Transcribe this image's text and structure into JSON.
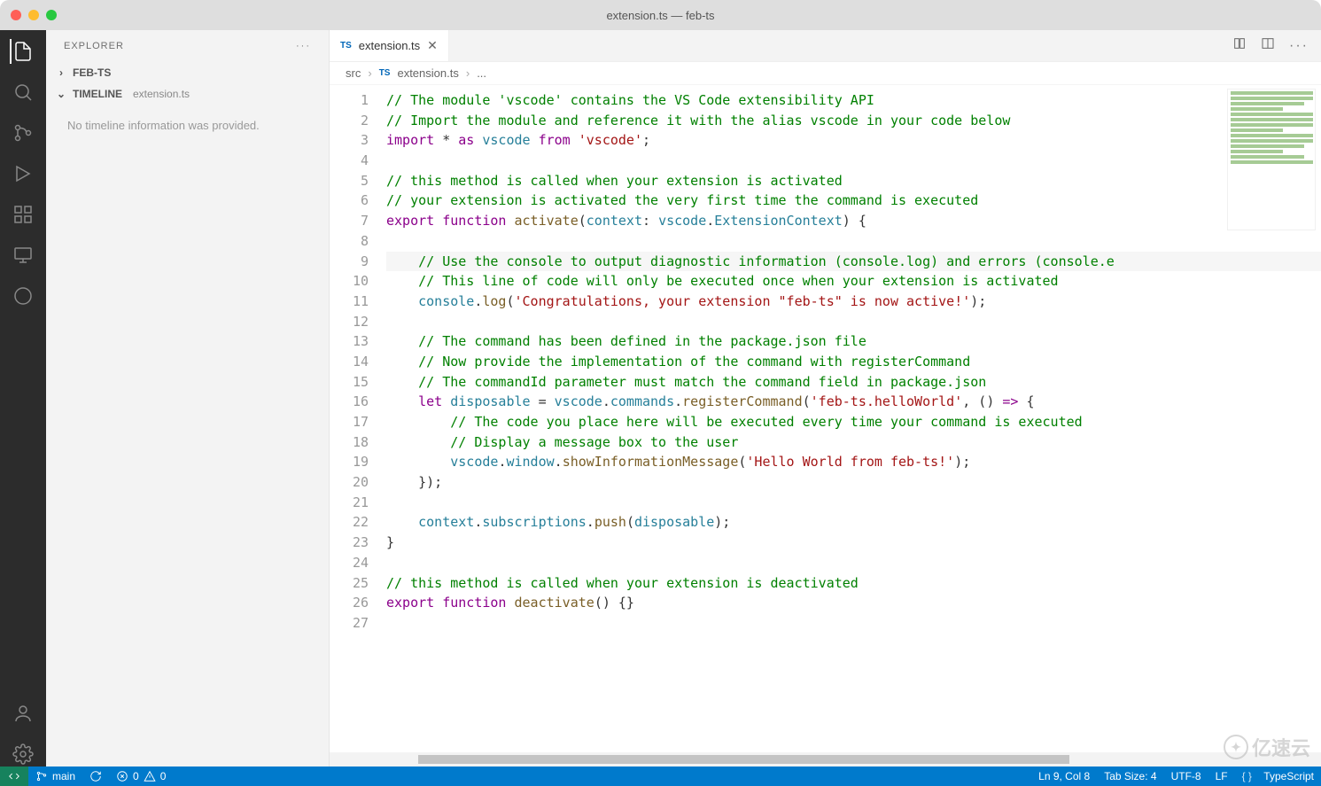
{
  "window": {
    "title": "extension.ts — feb-ts"
  },
  "sidebar": {
    "title": "EXPLORER",
    "project": "FEB-TS",
    "timeline_label": "TIMELINE",
    "timeline_sub": "extension.ts",
    "timeline_empty": "No timeline information was provided."
  },
  "tab": {
    "badge": "TS",
    "name": "extension.ts"
  },
  "breadcrumbs": {
    "a": "src",
    "badge": "TS",
    "b": "extension.ts",
    "c": "..."
  },
  "code": {
    "lines": [
      [
        [
          "cm",
          "// The module 'vscode' contains the VS Code extensibility API"
        ]
      ],
      [
        [
          "cm",
          "// Import the module and reference it with the alias vscode in your code below"
        ]
      ],
      [
        [
          "kw",
          "import"
        ],
        [
          "op",
          " * "
        ],
        [
          "kw",
          "as"
        ],
        [
          "op",
          " "
        ],
        [
          "id",
          "vscode"
        ],
        [
          "op",
          " "
        ],
        [
          "kw",
          "from"
        ],
        [
          "op",
          " "
        ],
        [
          "str",
          "'vscode'"
        ],
        [
          "op",
          ";"
        ]
      ],
      [
        [
          "op",
          ""
        ]
      ],
      [
        [
          "cm",
          "// this method is called when your extension is activated"
        ]
      ],
      [
        [
          "cm",
          "// your extension is activated the very first time the command is executed"
        ]
      ],
      [
        [
          "kw",
          "export"
        ],
        [
          "op",
          " "
        ],
        [
          "kw",
          "function"
        ],
        [
          "op",
          " "
        ],
        [
          "call",
          "activate"
        ],
        [
          "op",
          "("
        ],
        [
          "id",
          "context"
        ],
        [
          "op",
          ": "
        ],
        [
          "id",
          "vscode"
        ],
        [
          "op",
          "."
        ],
        [
          "ty",
          "ExtensionContext"
        ],
        [
          "op",
          ") {"
        ]
      ],
      [
        [
          "op",
          ""
        ]
      ],
      [
        [
          "op",
          "    "
        ],
        [
          "cm",
          "// Use the console to output diagnostic information (console.log) and errors (console.e"
        ]
      ],
      [
        [
          "op",
          "    "
        ],
        [
          "cm",
          "// This line of code will only be executed once when your extension is activated"
        ]
      ],
      [
        [
          "op",
          "    "
        ],
        [
          "id",
          "console"
        ],
        [
          "op",
          "."
        ],
        [
          "call",
          "log"
        ],
        [
          "op",
          "("
        ],
        [
          "str",
          "'Congratulations, your extension \"feb-ts\" is now active!'"
        ],
        [
          "op",
          ");"
        ]
      ],
      [
        [
          "op",
          ""
        ]
      ],
      [
        [
          "op",
          "    "
        ],
        [
          "cm",
          "// The command has been defined in the package.json file"
        ]
      ],
      [
        [
          "op",
          "    "
        ],
        [
          "cm",
          "// Now provide the implementation of the command with registerCommand"
        ]
      ],
      [
        [
          "op",
          "    "
        ],
        [
          "cm",
          "// The commandId parameter must match the command field in package.json"
        ]
      ],
      [
        [
          "op",
          "    "
        ],
        [
          "kw",
          "let"
        ],
        [
          "op",
          " "
        ],
        [
          "id",
          "disposable"
        ],
        [
          "op",
          " = "
        ],
        [
          "id",
          "vscode"
        ],
        [
          "op",
          "."
        ],
        [
          "id",
          "commands"
        ],
        [
          "op",
          "."
        ],
        [
          "call",
          "registerCommand"
        ],
        [
          "op",
          "("
        ],
        [
          "str",
          "'feb-ts.helloWorld'"
        ],
        [
          "op",
          ", () "
        ],
        [
          "kw",
          "=>"
        ],
        [
          "op",
          " {"
        ]
      ],
      [
        [
          "op",
          "        "
        ],
        [
          "cm",
          "// The code you place here will be executed every time your command is executed"
        ]
      ],
      [
        [
          "op",
          "        "
        ],
        [
          "cm",
          "// Display a message box to the user"
        ]
      ],
      [
        [
          "op",
          "        "
        ],
        [
          "id",
          "vscode"
        ],
        [
          "op",
          "."
        ],
        [
          "id",
          "window"
        ],
        [
          "op",
          "."
        ],
        [
          "call",
          "showInformationMessage"
        ],
        [
          "op",
          "("
        ],
        [
          "str",
          "'Hello World from feb-ts!'"
        ],
        [
          "op",
          ");"
        ]
      ],
      [
        [
          "op",
          "    });"
        ]
      ],
      [
        [
          "op",
          ""
        ]
      ],
      [
        [
          "op",
          "    "
        ],
        [
          "id",
          "context"
        ],
        [
          "op",
          "."
        ],
        [
          "id",
          "subscriptions"
        ],
        [
          "op",
          "."
        ],
        [
          "call",
          "push"
        ],
        [
          "op",
          "("
        ],
        [
          "id",
          "disposable"
        ],
        [
          "op",
          ");"
        ]
      ],
      [
        [
          "op",
          "}"
        ]
      ],
      [
        [
          "op",
          ""
        ]
      ],
      [
        [
          "cm",
          "// this method is called when your extension is deactivated"
        ]
      ],
      [
        [
          "kw",
          "export"
        ],
        [
          "op",
          " "
        ],
        [
          "kw",
          "function"
        ],
        [
          "op",
          " "
        ],
        [
          "call",
          "deactivate"
        ],
        [
          "op",
          "() {}"
        ]
      ],
      [
        [
          "op",
          ""
        ]
      ]
    ],
    "highlight_index": 8
  },
  "status": {
    "branch": "main",
    "errors": "0",
    "warnings": "0",
    "cursor": "Ln 9, Col 8",
    "indent": "Tab Size: 4",
    "encoding": "UTF-8",
    "eol": "LF",
    "lang": "TypeScript"
  },
  "watermark": "亿速云"
}
